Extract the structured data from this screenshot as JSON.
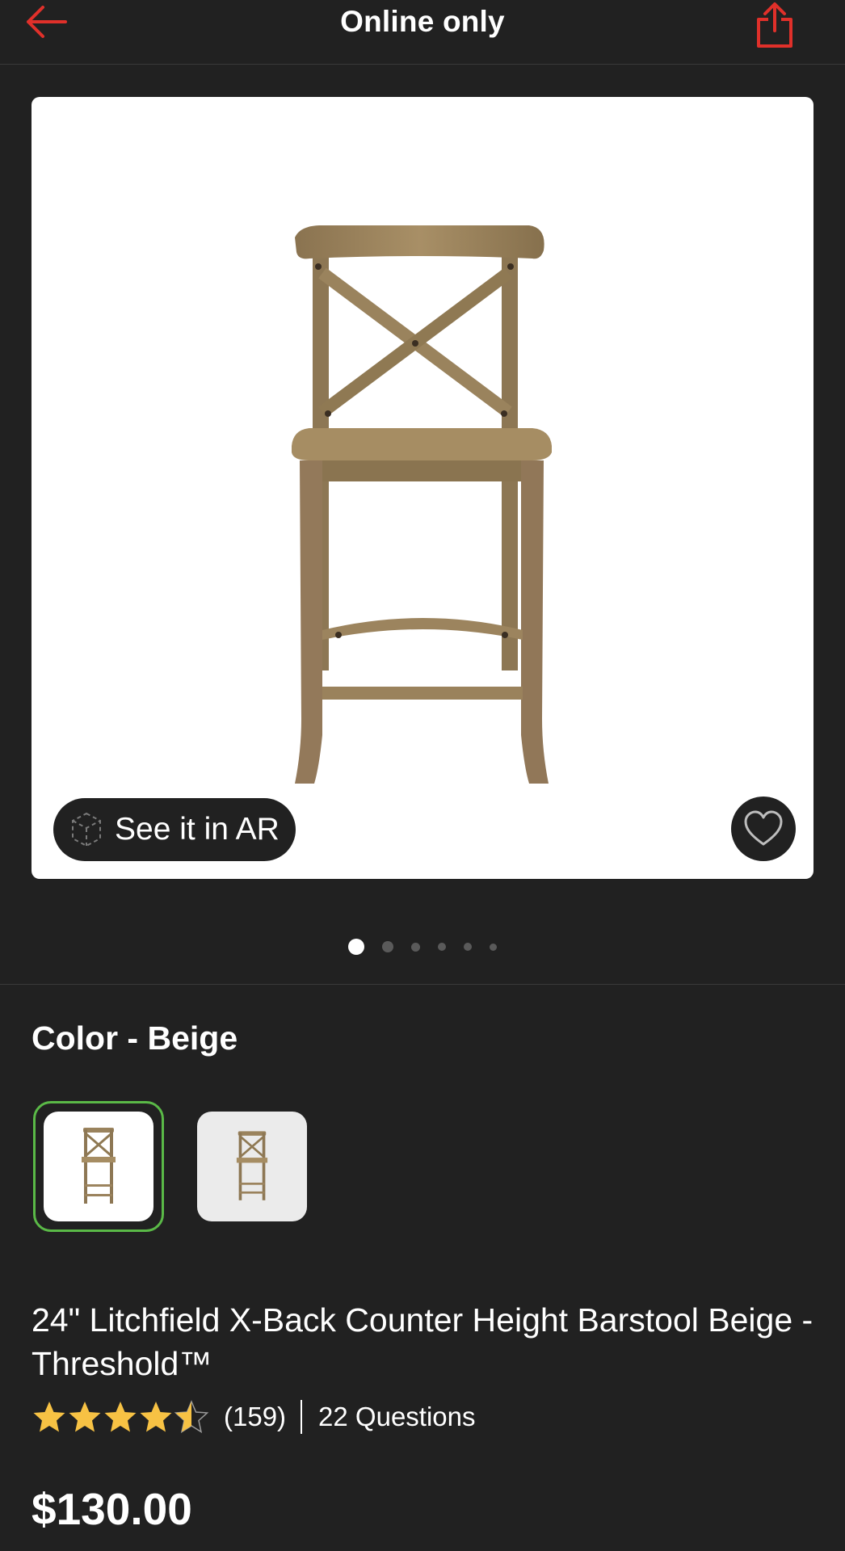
{
  "header": {
    "title": "Online only",
    "back_icon": "arrow-left-icon",
    "share_icon": "share-icon",
    "accent_color": "#e0302a"
  },
  "gallery": {
    "ar_button_label": "See it in AR",
    "ar_icon": "ar-cube-icon",
    "favorite_icon": "heart-outline-icon",
    "image_count": 6,
    "active_index": 0
  },
  "color": {
    "label": "Color - Beige",
    "swatches": [
      {
        "name": "beige-white-background",
        "selected": true
      },
      {
        "name": "beige-gray-background",
        "selected": false
      }
    ],
    "selected_ring_color": "#5ab947"
  },
  "product": {
    "title": "24\" Litchfield X-Back Counter Height Barstool Beige - Threshold™",
    "rating": 4.5,
    "review_count": "(159)",
    "questions": "22 Questions",
    "price": "$130.00",
    "star_color": "#f7c244"
  }
}
